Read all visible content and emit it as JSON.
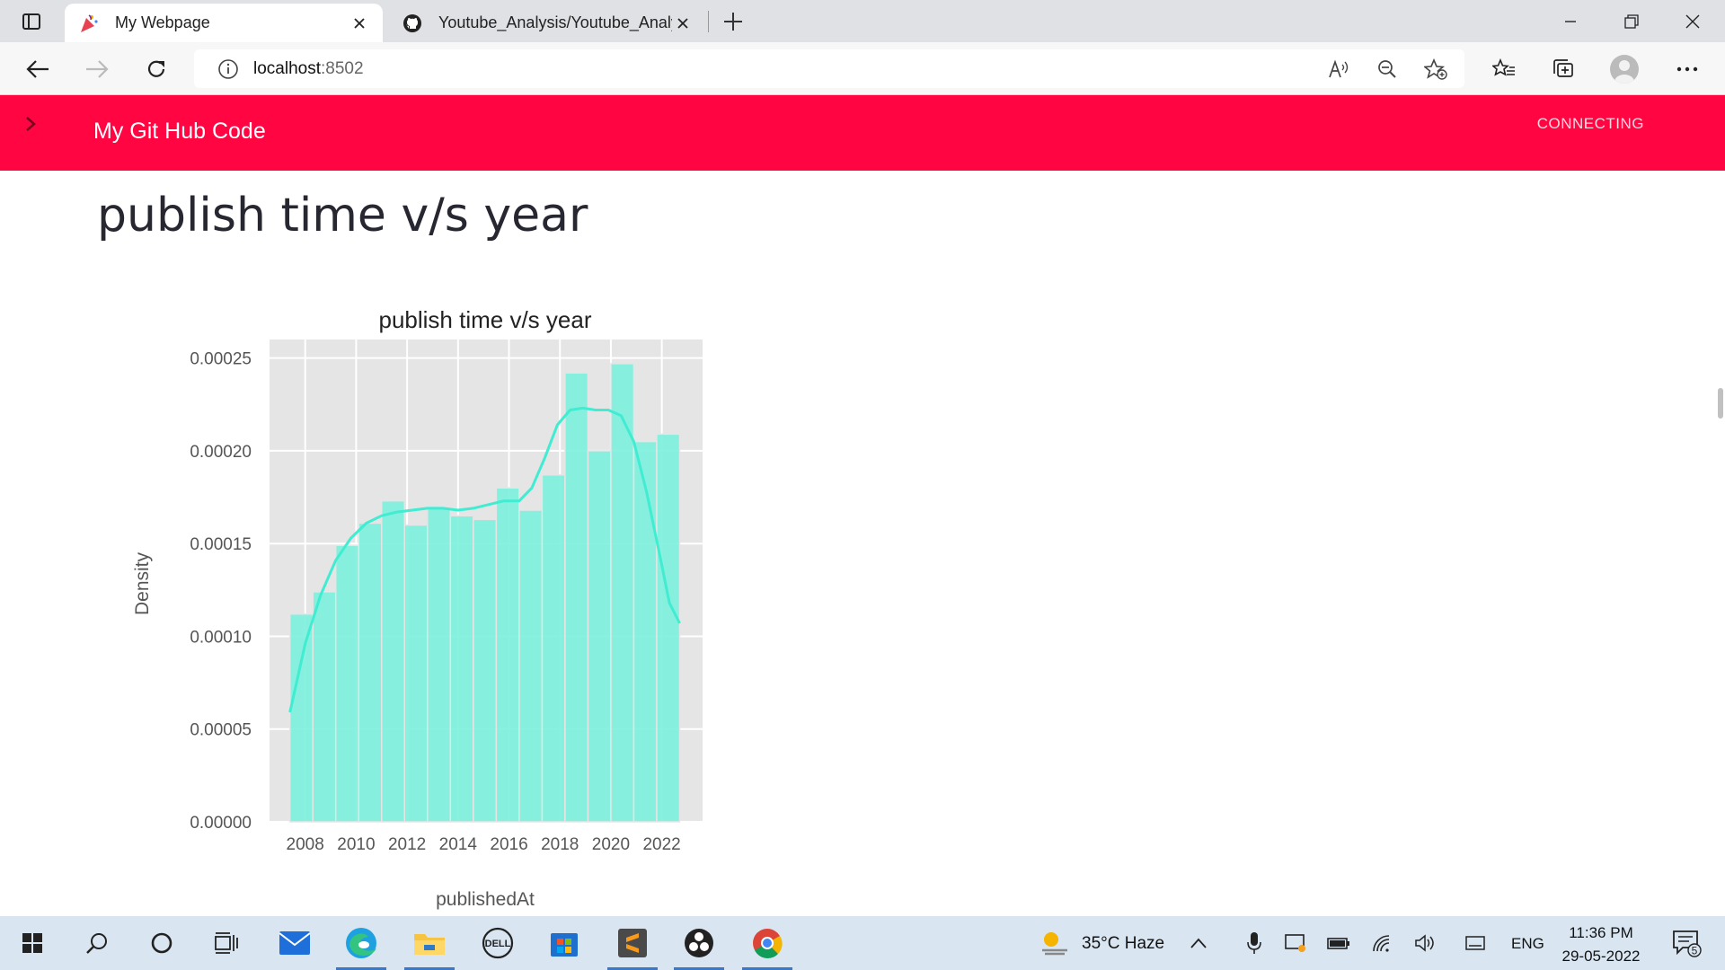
{
  "browser": {
    "tabs": [
      {
        "title": "My Webpage",
        "active": true
      },
      {
        "title": "Youtube_Analysis/Youtube_Analy",
        "active": false
      }
    ],
    "url_host": "localhost",
    "url_port": ":8502"
  },
  "app": {
    "header_title": "My Git Hub Code",
    "status": "CONNECTING",
    "accent_color": "#ff0541",
    "page_title": "publish time v/s year"
  },
  "chart_data": {
    "type": "bar",
    "title": "publish time v/s year",
    "xlabel": "publishedAt",
    "ylabel": "Density",
    "xlim": [
      2006.6,
      2023.6
    ],
    "ylim": [
      0,
      0.00026
    ],
    "xticks": [
      "2008",
      "2010",
      "2012",
      "2014",
      "2016",
      "2018",
      "2020",
      "2022"
    ],
    "yticks": [
      "0.00000",
      "0.00005",
      "0.00010",
      "0.00015",
      "0.00020",
      "0.00025"
    ],
    "grid": true,
    "bar_color": "#7ff0dc",
    "kde_color": "#40ecd2",
    "bins": [
      {
        "x0": 2007.4,
        "x1": 2008.3,
        "density": 0.000112
      },
      {
        "x0": 2008.3,
        "x1": 2009.2,
        "density": 0.000124
      },
      {
        "x0": 2009.2,
        "x1": 2010.1,
        "density": 0.000149
      },
      {
        "x0": 2010.1,
        "x1": 2011.0,
        "density": 0.000161
      },
      {
        "x0": 2011.0,
        "x1": 2011.9,
        "density": 0.000173
      },
      {
        "x0": 2011.9,
        "x1": 2012.8,
        "density": 0.00016
      },
      {
        "x0": 2012.8,
        "x1": 2013.7,
        "density": 0.000169
      },
      {
        "x0": 2013.7,
        "x1": 2014.6,
        "density": 0.000165
      },
      {
        "x0": 2014.6,
        "x1": 2015.5,
        "density": 0.000163
      },
      {
        "x0": 2015.5,
        "x1": 2016.4,
        "density": 0.00018
      },
      {
        "x0": 2016.4,
        "x1": 2017.3,
        "density": 0.000168
      },
      {
        "x0": 2017.3,
        "x1": 2018.2,
        "density": 0.000187
      },
      {
        "x0": 2018.2,
        "x1": 2019.1,
        "density": 0.000242
      },
      {
        "x0": 2019.1,
        "x1": 2020.0,
        "density": 0.0002
      },
      {
        "x0": 2020.0,
        "x1": 2020.9,
        "density": 0.000247
      },
      {
        "x0": 2020.9,
        "x1": 2021.8,
        "density": 0.000205
      },
      {
        "x0": 2021.8,
        "x1": 2022.7,
        "density": 0.000209
      }
    ],
    "kde": {
      "x": [
        2007.4,
        2008.0,
        2008.6,
        2009.2,
        2009.8,
        2010.4,
        2011.0,
        2011.6,
        2012.2,
        2012.8,
        2013.4,
        2014.0,
        2014.6,
        2015.2,
        2015.8,
        2016.4,
        2016.9,
        2017.4,
        2017.9,
        2018.4,
        2018.9,
        2019.4,
        2019.9,
        2020.4,
        2020.9,
        2021.4,
        2021.9,
        2022.3,
        2022.7
      ],
      "y": [
        5.9e-05,
        9.6e-05,
        0.000122,
        0.000141,
        0.000153,
        0.000161,
        0.000165,
        0.000167,
        0.000168,
        0.000169,
        0.000169,
        0.000168,
        0.000169,
        0.000171,
        0.000173,
        0.000173,
        0.00018,
        0.000196,
        0.000214,
        0.000222,
        0.000223,
        0.000222,
        0.000222,
        0.000219,
        0.000205,
        0.000178,
        0.000145,
        0.000118,
        0.000107
      ]
    }
  },
  "taskbar": {
    "weather": "35°C  Haze",
    "language": "ENG",
    "time": "11:36 PM",
    "date": "29-05-2022",
    "notifications": "5"
  }
}
